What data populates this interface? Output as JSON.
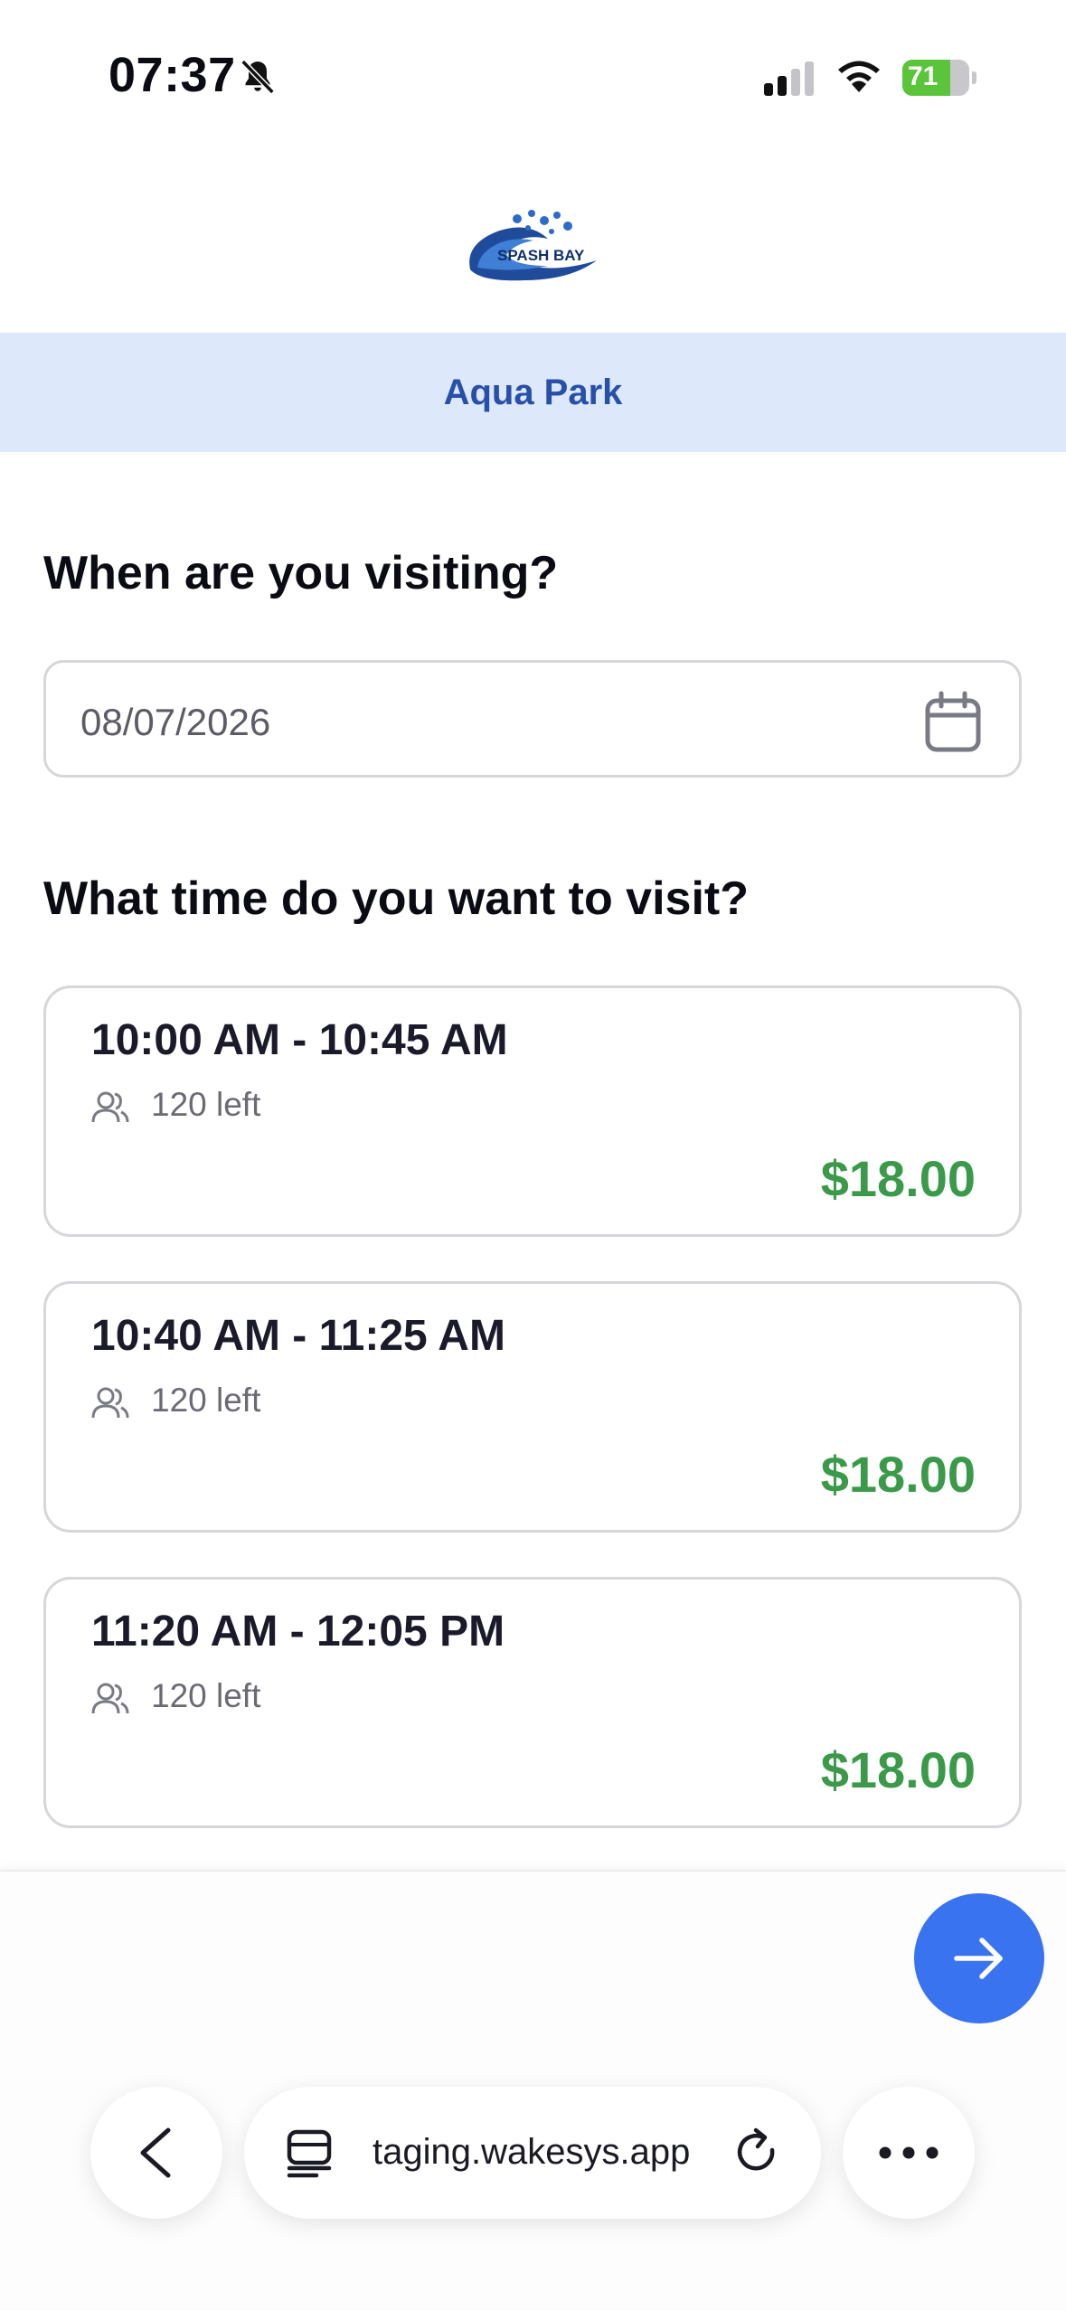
{
  "status": {
    "time": "07:37",
    "battery": "71",
    "battery_level": 0.71
  },
  "brand": {
    "logo_text": "SPASH BAY",
    "park_name": "Aqua Park"
  },
  "date_section": {
    "heading": "When are you visiting?",
    "date_value": "08/07/2026"
  },
  "time_section": {
    "heading": "What time do you want to visit?",
    "slots": [
      {
        "time": "10:00 AM - 10:45 AM",
        "availability": "120 left",
        "price": "$18.00"
      },
      {
        "time": "10:40 AM - 11:25 AM",
        "availability": "120 left",
        "price": "$18.00"
      },
      {
        "time": "11:20 AM - 12:05 PM",
        "availability": "120 left",
        "price": "$18.00"
      }
    ]
  },
  "browser": {
    "url": "taging.wakesys.app"
  },
  "icons": {
    "silent": "bell-off-icon",
    "signal": "cellular-signal-icon",
    "wifi": "wifi-icon",
    "battery": "battery-icon",
    "calendar": "calendar-icon",
    "people": "people-icon",
    "next": "arrow-right-icon",
    "back": "chevron-left-icon",
    "tabs": "tabs-icon",
    "reload": "reload-icon",
    "more": "ellipsis-icon"
  },
  "colors": {
    "accent": "#3a73f0",
    "banner_bg": "#dde8fb",
    "banner_text": "#2850a8",
    "price": "#3b9a4a"
  }
}
